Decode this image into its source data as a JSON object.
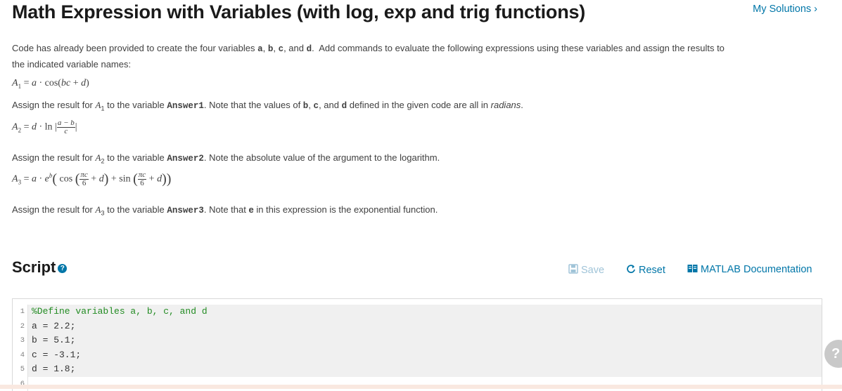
{
  "page": {
    "title": "Math Expression with Variables (with log, exp and trig functions)",
    "my_solutions": "My Solutions ›"
  },
  "problem": {
    "intro_1": "Code has already been provided to create the four variables ",
    "intro_vars": [
      "a",
      "b",
      "c",
      "d"
    ],
    "intro_2": "Add commands to evaluate the following expressions using these variables and assign the results to",
    "intro_3": "the indicated variable names:",
    "eq1": {
      "lhs": "A",
      "sub": "1",
      "rhs": "= a · cos(bc + d)"
    },
    "assign1": {
      "pre": "Assign the result for ",
      "var": "A",
      "sub": "1",
      "mid": " to the variable ",
      "answer": "Answer1",
      "post": ". Note that the values of ",
      "post2": " defined in the given code are all in ",
      "radians": "radians",
      "end": "."
    },
    "eq2": {
      "lhs": "A",
      "sub": "2",
      "num": "a − b",
      "den": "c"
    },
    "assign2": {
      "pre": "Assign the result for ",
      "var": "A",
      "sub": "2",
      "mid": " to the variable ",
      "answer": "Answer2",
      "post": ". Note the absolute value of the argument to the logarithm."
    },
    "eq3": {
      "lhs": "A",
      "sub": "3",
      "frac_num": "πc",
      "frac_den": "6"
    },
    "assign3": {
      "pre": "Assign the result for ",
      "var": "A",
      "sub": "3",
      "mid": " to the variable ",
      "answer": "Answer3",
      "post": ". Note that ",
      "e": "e",
      "post2": " in this expression is the exponential function."
    }
  },
  "script": {
    "title": "Script",
    "help_icon": "?",
    "toolbar": {
      "save": "Save",
      "reset": "Reset",
      "documentation": "MATLAB Documentation"
    },
    "lines": [
      {
        "num": "1",
        "text": "%Define variables a, b, c, and d",
        "type": "comment"
      },
      {
        "num": "2",
        "text": "a = 2.2;",
        "type": "code"
      },
      {
        "num": "3",
        "text": "b = 5.1;",
        "type": "code"
      },
      {
        "num": "4",
        "text": "c = -3.1;",
        "type": "code"
      },
      {
        "num": "5",
        "text": "d = 1.8;",
        "type": "code"
      },
      {
        "num": "6",
        "text": "",
        "type": "empty"
      }
    ]
  },
  "colors": {
    "link": "#0076a8",
    "comment": "#228b22",
    "title": "#1a1a1a"
  }
}
